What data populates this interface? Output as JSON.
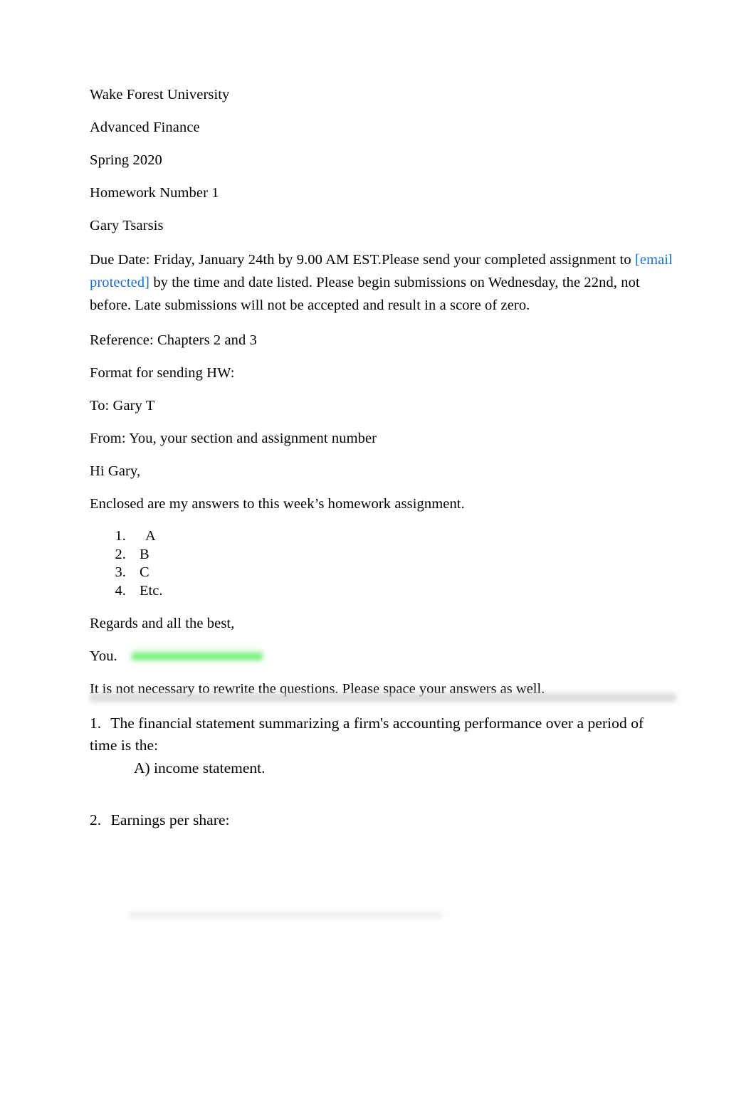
{
  "document": {
    "header_lines": [
      "Wake Forest University",
      "Advanced Finance",
      "Spring 2020",
      "Homework Number 1",
      "Gary Tsarsis"
    ],
    "due_date": {
      "before_link": "Due Date:   Friday, January 24th by 9.00 AM EST.Please send your completed assignment to ",
      "link_text": "[email protected]",
      "after_link": "  by the time and date listed.   Please begin submissions on Wednesday, the 22nd, not before.  Late submissions will not be accepted and result in a score of zero.",
      "link_color": "#1d6fd0"
    },
    "reference": "Reference:  Chapters 2 and 3",
    "format_heading": "Format for sending HW:",
    "to_line": "To:  Gary T",
    "from_line": "From:  You, your section and assignment number",
    "salutation": "Hi Gary,",
    "enclosed_line": "Enclosed are my answers to this week’s homework assignment.",
    "answer_list": [
      "A",
      "B",
      "C",
      "Etc."
    ],
    "closing": "Regards and all the best,",
    "signature": "You.",
    "note_line": "It is not necessary to rewrite the questions.   Please space your answers as well.",
    "questions": [
      {
        "number": "1.",
        "text": "The financial statement summarizing a firm's accounting performance over a period of time is the:",
        "highlight_color": "#4ae850",
        "choices": [
          "A) income statement."
        ]
      },
      {
        "number": "2.",
        "text": "Earnings per share:"
      }
    ]
  }
}
